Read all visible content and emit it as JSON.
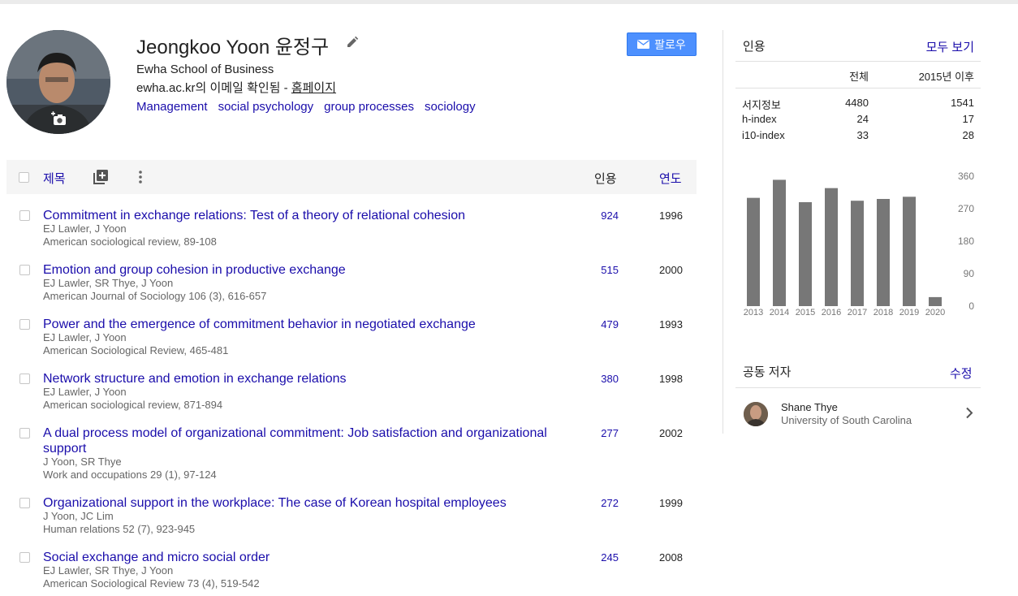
{
  "profile": {
    "name": "Jeongkoo Yoon 윤정구",
    "affiliation": "Ewha School of Business",
    "email_text": "ewha.ac.kr의 이메일 확인됨 - ",
    "homepage_label": "홈페이지",
    "interests": [
      "Management",
      "social psychology",
      "group processes",
      "sociology"
    ],
    "follow_label": "팔로우"
  },
  "table": {
    "title_header": "제목",
    "cited_header": "인용",
    "year_header": "연도",
    "rows": [
      {
        "title": "Commitment in exchange relations: Test of a theory of relational cohesion",
        "authors": "EJ Lawler, J Yoon",
        "venue": "American sociological review, 89-108",
        "cited": "924",
        "year": "1996"
      },
      {
        "title": "Emotion and group cohesion in productive exchange",
        "authors": "EJ Lawler, SR Thye, J Yoon",
        "venue": "American Journal of Sociology 106 (3), 616-657",
        "cited": "515",
        "year": "2000"
      },
      {
        "title": "Power and the emergence of commitment behavior in negotiated exchange",
        "authors": "EJ Lawler, J Yoon",
        "venue": "American Sociological Review, 465-481",
        "cited": "479",
        "year": "1993"
      },
      {
        "title": "Network structure and emotion in exchange relations",
        "authors": "EJ Lawler, J Yoon",
        "venue": "American sociological review, 871-894",
        "cited": "380",
        "year": "1998"
      },
      {
        "title": "A dual process model of organizational commitment: Job satisfaction and organizational support",
        "authors": "J Yoon, SR Thye",
        "venue": "Work and occupations 29 (1), 97-124",
        "cited": "277",
        "year": "2002"
      },
      {
        "title": "Organizational support in the workplace: The case of Korean hospital employees",
        "authors": "J Yoon, JC Lim",
        "venue": "Human relations 52 (7), 923-945",
        "cited": "272",
        "year": "1999"
      },
      {
        "title": "Social exchange and micro social order",
        "authors": "EJ Lawler, SR Thye, J Yoon",
        "venue": "American Sociological Review 73 (4), 519-542",
        "cited": "245",
        "year": "2008"
      }
    ]
  },
  "citations": {
    "heading": "인용",
    "view_all": "모두 보기",
    "col_all": "전체",
    "col_since": "2015년 이후",
    "stats": [
      {
        "label": "서지정보",
        "all": "4480",
        "since": "1541"
      },
      {
        "label": "h-index",
        "all": "24",
        "since": "17"
      },
      {
        "label": "i10-index",
        "all": "33",
        "since": "28"
      }
    ]
  },
  "chart_data": {
    "type": "bar",
    "categories": [
      "2013",
      "2014",
      "2015",
      "2016",
      "2017",
      "2018",
      "2019",
      "2020"
    ],
    "values": [
      300,
      350,
      288,
      327,
      292,
      297,
      303,
      25
    ],
    "ylim": [
      0,
      360
    ],
    "yticks": [
      "360",
      "270",
      "180",
      "90",
      "0"
    ],
    "bar_color": "#777777"
  },
  "coauthors": {
    "heading": "공동 저자",
    "edit_label": "수정",
    "items": [
      {
        "name": "Shane Thye",
        "affiliation": "University of South Carolina"
      }
    ]
  },
  "colors": {
    "link": "#1a0dab",
    "button": "#4d90fe"
  }
}
